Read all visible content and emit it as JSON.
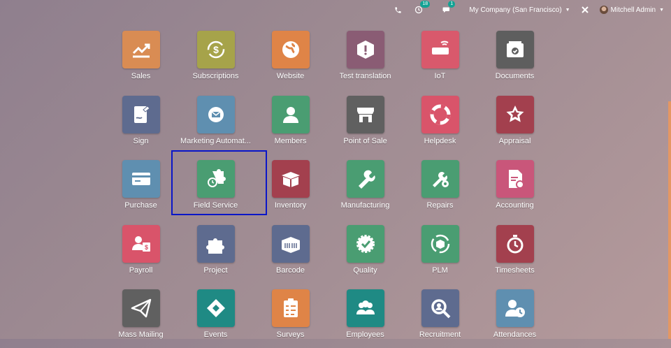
{
  "topbar": {
    "phone_icon": "phone-icon",
    "activity_count": "18",
    "messages_count": "1",
    "company": "My Company (San Francisco)",
    "user": "Mitchell Admin"
  },
  "apps": [
    {
      "label": "Sales",
      "color": "#d98c53",
      "icon": "chart-trend-icon"
    },
    {
      "label": "Subscriptions",
      "color": "#a6a34a",
      "icon": "dollar-cycle-icon"
    },
    {
      "label": "Website",
      "color": "#df8447",
      "icon": "globe-icon"
    },
    {
      "label": "Test translation",
      "color": "#8a5c74",
      "icon": "box-icon"
    },
    {
      "label": "IoT",
      "color": "#d9596c",
      "icon": "iot-device-icon"
    },
    {
      "label": "Documents",
      "color": "#5e5e5e",
      "icon": "inbox-check-icon"
    },
    {
      "label": "Sign",
      "color": "#5e6b8f",
      "icon": "sign-document-icon"
    },
    {
      "label": "Marketing Automat...",
      "color": "#5f8fb0",
      "icon": "gear-mail-icon"
    },
    {
      "label": "Members",
      "color": "#4a9d72",
      "icon": "user-icon"
    },
    {
      "label": "Point of Sale",
      "color": "#606060",
      "icon": "shop-icon"
    },
    {
      "label": "Helpdesk",
      "color": "#d9546a",
      "icon": "lifebuoy-icon"
    },
    {
      "label": "Appraisal",
      "color": "#a3404e",
      "icon": "star-badge-icon"
    },
    {
      "label": "Purchase",
      "color": "#5f8fb0",
      "icon": "credit-card-icon"
    },
    {
      "label": "Field Service",
      "color": "#4a9d72",
      "icon": "puzzle-timer-icon"
    },
    {
      "label": "Inventory",
      "color": "#a3404e",
      "icon": "open-box-icon"
    },
    {
      "label": "Manufacturing",
      "color": "#4a9d72",
      "icon": "wrench-icon"
    },
    {
      "label": "Repairs",
      "color": "#4a9d72",
      "icon": "tools-gear-icon"
    },
    {
      "label": "Accounting",
      "color": "#c9567a",
      "icon": "invoice-gear-icon"
    },
    {
      "label": "Payroll",
      "color": "#d9546a",
      "icon": "payroll-icon"
    },
    {
      "label": "Project",
      "color": "#5e6b8f",
      "icon": "puzzle-icon"
    },
    {
      "label": "Barcode",
      "color": "#5e6b8f",
      "icon": "barcode-box-icon"
    },
    {
      "label": "Quality",
      "color": "#4a9d72",
      "icon": "quality-seal-icon"
    },
    {
      "label": "PLM",
      "color": "#4a9d72",
      "icon": "cycle-box-icon"
    },
    {
      "label": "Timesheets",
      "color": "#a3404e",
      "icon": "stopwatch-icon"
    },
    {
      "label": "Mass Mailing",
      "color": "#606060",
      "icon": "paper-plane-icon"
    },
    {
      "label": "Events",
      "color": "#1f8a84",
      "icon": "ticket-icon"
    },
    {
      "label": "Surveys",
      "color": "#df8447",
      "icon": "clipboard-icon"
    },
    {
      "label": "Employees",
      "color": "#1f8a84",
      "icon": "team-icon"
    },
    {
      "label": "Recruitment",
      "color": "#5e6b8f",
      "icon": "magnifier-icon"
    },
    {
      "label": "Attendances",
      "color": "#5f8fb0",
      "icon": "user-clock-icon"
    }
  ]
}
